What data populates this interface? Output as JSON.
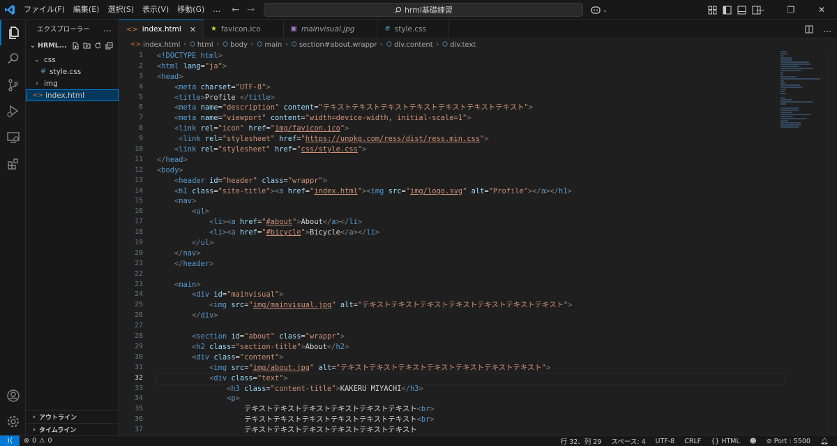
{
  "menu": [
    "ファイル(F)",
    "編集(E)",
    "選択(S)",
    "表示(V)",
    "移動(G)",
    "…"
  ],
  "search": {
    "text": "hrml基礎練習"
  },
  "sidebar": {
    "title": "エクスプローラー",
    "more": "…",
    "folder": "HRML...",
    "items": [
      {
        "label": "css",
        "type": "folder",
        "open": true
      },
      {
        "label": "style.css",
        "type": "css"
      },
      {
        "label": "img",
        "type": "folder",
        "open": false
      },
      {
        "label": "index.html",
        "type": "html",
        "selected": true
      }
    ],
    "outline": "アウトライン",
    "timeline": "タイムライン"
  },
  "tabs": [
    {
      "label": "index.html",
      "icon": "<>",
      "active": true,
      "close": "✕"
    },
    {
      "label": "favicon.ico",
      "icon": "★"
    },
    {
      "label": "mainvisual.jpg",
      "icon": "▣"
    },
    {
      "label": "style.css",
      "icon": "#"
    }
  ],
  "breadcrumb": [
    "index.html",
    "html",
    "body",
    "main",
    "section#about.wrappr",
    "div.content",
    "div.text"
  ],
  "editor": {
    "current_line": 32,
    "lines": [
      [
        [
          "doctype",
          "<!DOCTYPE "
        ],
        [
          "tag",
          "html"
        ],
        [
          "punct",
          ">"
        ]
      ],
      [
        [
          "punct",
          "<"
        ],
        [
          "tag",
          "html"
        ],
        [
          "text",
          " "
        ],
        [
          "attr",
          "lang"
        ],
        [
          "text",
          "="
        ],
        [
          "str",
          "\"ja\""
        ],
        [
          "punct",
          ">"
        ]
      ],
      [
        [
          "punct",
          "<"
        ],
        [
          "tag",
          "head"
        ],
        [
          "punct",
          ">"
        ]
      ],
      [
        [
          "text",
          "    "
        ],
        [
          "punct",
          "<"
        ],
        [
          "tag",
          "meta"
        ],
        [
          "text",
          " "
        ],
        [
          "attr",
          "charset"
        ],
        [
          "text",
          "="
        ],
        [
          "str",
          "\"UTF-8\""
        ],
        [
          "punct",
          ">"
        ]
      ],
      [
        [
          "text",
          "    "
        ],
        [
          "punct",
          "<"
        ],
        [
          "tag",
          "title"
        ],
        [
          "punct",
          ">"
        ],
        [
          "text",
          "Profile "
        ],
        [
          "punct",
          "</"
        ],
        [
          "tag",
          "title"
        ],
        [
          "punct",
          ">"
        ]
      ],
      [
        [
          "text",
          "    "
        ],
        [
          "punct",
          "<"
        ],
        [
          "tag",
          "meta"
        ],
        [
          "text",
          " "
        ],
        [
          "attr",
          "name"
        ],
        [
          "text",
          "="
        ],
        [
          "str",
          "\"description\""
        ],
        [
          "text",
          " "
        ],
        [
          "attr",
          "content"
        ],
        [
          "text",
          "="
        ],
        [
          "str",
          "\"テキストテキストテキストテキストテキストテキストテキスト\""
        ],
        [
          "punct",
          ">"
        ]
      ],
      [
        [
          "text",
          "    "
        ],
        [
          "punct",
          "<"
        ],
        [
          "tag",
          "meta"
        ],
        [
          "text",
          " "
        ],
        [
          "attr",
          "name"
        ],
        [
          "text",
          "="
        ],
        [
          "str",
          "\"viewport\""
        ],
        [
          "text",
          " "
        ],
        [
          "attr",
          "content"
        ],
        [
          "text",
          "="
        ],
        [
          "str",
          "\"width=device-width, initial-scale=1\""
        ],
        [
          "punct",
          ">"
        ]
      ],
      [
        [
          "text",
          "    "
        ],
        [
          "punct",
          "<"
        ],
        [
          "tag",
          "link"
        ],
        [
          "text",
          " "
        ],
        [
          "attr",
          "rel"
        ],
        [
          "text",
          "="
        ],
        [
          "str",
          "\"icon\""
        ],
        [
          "text",
          " "
        ],
        [
          "attr",
          "href"
        ],
        [
          "text",
          "="
        ],
        [
          "str",
          "\""
        ],
        [
          "link",
          "img/favicon.ico"
        ],
        [
          "str",
          "\""
        ],
        [
          "punct",
          ">"
        ]
      ],
      [
        [
          "text",
          "     "
        ],
        [
          "punct",
          "<"
        ],
        [
          "tag",
          "link"
        ],
        [
          "text",
          " "
        ],
        [
          "attr",
          "rel"
        ],
        [
          "text",
          "="
        ],
        [
          "str",
          "\"stylesheet\""
        ],
        [
          "text",
          " "
        ],
        [
          "attr",
          "href"
        ],
        [
          "text",
          "="
        ],
        [
          "str",
          "\""
        ],
        [
          "link",
          "https://unpkg.com/ress/dist/ress.min.css"
        ],
        [
          "str",
          "\""
        ],
        [
          "punct",
          ">"
        ]
      ],
      [
        [
          "text",
          "    "
        ],
        [
          "punct",
          "<"
        ],
        [
          "tag",
          "link"
        ],
        [
          "text",
          " "
        ],
        [
          "attr",
          "rel"
        ],
        [
          "text",
          "="
        ],
        [
          "str",
          "\"stylesheet\""
        ],
        [
          "text",
          " "
        ],
        [
          "attr",
          "href"
        ],
        [
          "text",
          "="
        ],
        [
          "str",
          "\""
        ],
        [
          "link",
          "css/style.css"
        ],
        [
          "str",
          "\""
        ],
        [
          "punct",
          ">"
        ]
      ],
      [
        [
          "punct",
          "</"
        ],
        [
          "tag",
          "head"
        ],
        [
          "punct",
          ">"
        ]
      ],
      [
        [
          "punct",
          "<"
        ],
        [
          "tag",
          "body"
        ],
        [
          "punct",
          ">"
        ]
      ],
      [
        [
          "text",
          "    "
        ],
        [
          "punct",
          "<"
        ],
        [
          "tag",
          "header"
        ],
        [
          "text",
          " "
        ],
        [
          "attr",
          "id"
        ],
        [
          "text",
          "="
        ],
        [
          "str",
          "\"header\""
        ],
        [
          "text",
          " "
        ],
        [
          "attr",
          "class"
        ],
        [
          "text",
          "="
        ],
        [
          "str",
          "\"wrappr\""
        ],
        [
          "punct",
          ">"
        ]
      ],
      [
        [
          "text",
          "    "
        ],
        [
          "punct",
          "<"
        ],
        [
          "tag",
          "h1"
        ],
        [
          "text",
          " "
        ],
        [
          "attr",
          "class"
        ],
        [
          "text",
          "="
        ],
        [
          "str",
          "\"site-title\""
        ],
        [
          "punct",
          "><"
        ],
        [
          "tag",
          "a"
        ],
        [
          "text",
          " "
        ],
        [
          "attr",
          "href"
        ],
        [
          "text",
          "="
        ],
        [
          "str",
          "\""
        ],
        [
          "link",
          "index.html"
        ],
        [
          "str",
          "\""
        ],
        [
          "punct",
          "><"
        ],
        [
          "tag",
          "img"
        ],
        [
          "text",
          " "
        ],
        [
          "attr",
          "src"
        ],
        [
          "text",
          "="
        ],
        [
          "str",
          "\""
        ],
        [
          "link",
          "img/logo.svg"
        ],
        [
          "str",
          "\""
        ],
        [
          "text",
          " "
        ],
        [
          "attr",
          "alt"
        ],
        [
          "text",
          "="
        ],
        [
          "str",
          "\"Profile\""
        ],
        [
          "punct",
          "></"
        ],
        [
          "tag",
          "a"
        ],
        [
          "punct",
          "></"
        ],
        [
          "tag",
          "h1"
        ],
        [
          "punct",
          ">"
        ]
      ],
      [
        [
          "text",
          "    "
        ],
        [
          "punct",
          "<"
        ],
        [
          "tag",
          "nav"
        ],
        [
          "punct",
          ">"
        ]
      ],
      [
        [
          "text",
          "        "
        ],
        [
          "punct",
          "<"
        ],
        [
          "tag",
          "ul"
        ],
        [
          "punct",
          ">"
        ]
      ],
      [
        [
          "text",
          "            "
        ],
        [
          "punct",
          "<"
        ],
        [
          "tag",
          "li"
        ],
        [
          "punct",
          "><"
        ],
        [
          "tag",
          "a"
        ],
        [
          "text",
          " "
        ],
        [
          "attr",
          "href"
        ],
        [
          "text",
          "="
        ],
        [
          "str",
          "\""
        ],
        [
          "link",
          "#about"
        ],
        [
          "str",
          "\""
        ],
        [
          "punct",
          ">"
        ],
        [
          "text",
          "About"
        ],
        [
          "punct",
          "</"
        ],
        [
          "tag",
          "a"
        ],
        [
          "punct",
          "></"
        ],
        [
          "tag",
          "li"
        ],
        [
          "punct",
          ">"
        ]
      ],
      [
        [
          "text",
          "            "
        ],
        [
          "punct",
          "<"
        ],
        [
          "tag",
          "li"
        ],
        [
          "punct",
          "><"
        ],
        [
          "tag",
          "a"
        ],
        [
          "text",
          " "
        ],
        [
          "attr",
          "href"
        ],
        [
          "text",
          "="
        ],
        [
          "str",
          "\""
        ],
        [
          "link",
          "#bicycle"
        ],
        [
          "str",
          "\""
        ],
        [
          "punct",
          ">"
        ],
        [
          "text",
          "Bicycle"
        ],
        [
          "punct",
          "</"
        ],
        [
          "tag",
          "a"
        ],
        [
          "punct",
          "></"
        ],
        [
          "tag",
          "li"
        ],
        [
          "punct",
          ">"
        ]
      ],
      [
        [
          "text",
          "        "
        ],
        [
          "punct",
          "</"
        ],
        [
          "tag",
          "ul"
        ],
        [
          "punct",
          ">"
        ]
      ],
      [
        [
          "text",
          "    "
        ],
        [
          "punct",
          "</"
        ],
        [
          "tag",
          "nav"
        ],
        [
          "punct",
          ">"
        ]
      ],
      [
        [
          "text",
          "    "
        ],
        [
          "punct",
          "</"
        ],
        [
          "tag",
          "header"
        ],
        [
          "punct",
          ">"
        ]
      ],
      [],
      [
        [
          "text",
          "    "
        ],
        [
          "punct",
          "<"
        ],
        [
          "tag",
          "main"
        ],
        [
          "punct",
          ">"
        ]
      ],
      [
        [
          "text",
          "        "
        ],
        [
          "punct",
          "<"
        ],
        [
          "tag",
          "div"
        ],
        [
          "text",
          " "
        ],
        [
          "attr",
          "id"
        ],
        [
          "text",
          "="
        ],
        [
          "str",
          "\"mainvisual\""
        ],
        [
          "punct",
          ">"
        ]
      ],
      [
        [
          "text",
          "            "
        ],
        [
          "punct",
          "<"
        ],
        [
          "tag",
          "img"
        ],
        [
          "text",
          " "
        ],
        [
          "attr",
          "src"
        ],
        [
          "text",
          "="
        ],
        [
          "str",
          "\""
        ],
        [
          "link",
          "img/mainvisual.jpg"
        ],
        [
          "str",
          "\""
        ],
        [
          "text",
          " "
        ],
        [
          "attr",
          "alt"
        ],
        [
          "text",
          "="
        ],
        [
          "str",
          "\"テキストテキストテキストテキストテキストテキストテキスト\""
        ],
        [
          "punct",
          ">"
        ]
      ],
      [
        [
          "text",
          "        "
        ],
        [
          "punct",
          "</"
        ],
        [
          "tag",
          "div"
        ],
        [
          "punct",
          ">"
        ]
      ],
      [],
      [
        [
          "text",
          "        "
        ],
        [
          "punct",
          "<"
        ],
        [
          "tag",
          "section"
        ],
        [
          "text",
          " "
        ],
        [
          "attr",
          "id"
        ],
        [
          "text",
          "="
        ],
        [
          "str",
          "\"about\""
        ],
        [
          "text",
          " "
        ],
        [
          "attr",
          "class"
        ],
        [
          "text",
          "="
        ],
        [
          "str",
          "\"wrappr\""
        ],
        [
          "punct",
          ">"
        ]
      ],
      [
        [
          "text",
          "        "
        ],
        [
          "punct",
          "<"
        ],
        [
          "tag",
          "h2"
        ],
        [
          "text",
          " "
        ],
        [
          "attr",
          "class"
        ],
        [
          "text",
          "="
        ],
        [
          "str",
          "\"section-title\""
        ],
        [
          "punct",
          ">"
        ],
        [
          "text",
          "About"
        ],
        [
          "punct",
          "</"
        ],
        [
          "tag",
          "h2"
        ],
        [
          "punct",
          ">"
        ]
      ],
      [
        [
          "text",
          "        "
        ],
        [
          "punct",
          "<"
        ],
        [
          "tag",
          "div"
        ],
        [
          "text",
          " "
        ],
        [
          "attr",
          "class"
        ],
        [
          "text",
          "="
        ],
        [
          "str",
          "\"content\""
        ],
        [
          "punct",
          ">"
        ]
      ],
      [
        [
          "text",
          "            "
        ],
        [
          "punct",
          "<"
        ],
        [
          "tag",
          "img"
        ],
        [
          "text",
          " "
        ],
        [
          "attr",
          "src"
        ],
        [
          "text",
          "="
        ],
        [
          "str",
          "\""
        ],
        [
          "link",
          "img/about.jpg"
        ],
        [
          "str",
          "\""
        ],
        [
          "text",
          " "
        ],
        [
          "attr",
          "alt"
        ],
        [
          "text",
          "="
        ],
        [
          "str",
          "\"テキストテキストテキストテキストテキストテキストテキスト\""
        ],
        [
          "punct",
          ">"
        ]
      ],
      [
        [
          "text",
          "            "
        ],
        [
          "punct",
          "<"
        ],
        [
          "tag",
          "div"
        ],
        [
          "text",
          " "
        ],
        [
          "attr",
          "class"
        ],
        [
          "text",
          "="
        ],
        [
          "str",
          "\"text\""
        ],
        [
          "punct",
          ">"
        ]
      ],
      [
        [
          "text",
          "                "
        ],
        [
          "punct",
          "<"
        ],
        [
          "tag",
          "h3"
        ],
        [
          "text",
          " "
        ],
        [
          "attr",
          "class"
        ],
        [
          "text",
          "="
        ],
        [
          "str",
          "\"content-title\""
        ],
        [
          "punct",
          ">"
        ],
        [
          "text",
          "KAKERU MIYACHI"
        ],
        [
          "punct",
          "</"
        ],
        [
          "tag",
          "h3"
        ],
        [
          "punct",
          ">"
        ]
      ],
      [
        [
          "text",
          "                "
        ],
        [
          "punct",
          "<"
        ],
        [
          "tag",
          "p"
        ],
        [
          "punct",
          ">"
        ]
      ],
      [
        [
          "text",
          "                    テキストテキストテキストテキストテキストテキスト"
        ],
        [
          "punct",
          "<"
        ],
        [
          "tag",
          "br"
        ],
        [
          "punct",
          ">"
        ]
      ],
      [
        [
          "text",
          "                    テキストテキストテキストテキストテキストテキスト"
        ],
        [
          "punct",
          "<"
        ],
        [
          "tag",
          "br"
        ],
        [
          "punct",
          ">"
        ]
      ],
      [
        [
          "text",
          "                    テキストテキストテキストテキストテキストテキスト"
        ]
      ]
    ]
  },
  "status": {
    "errors": "0",
    "warnings": "0",
    "position": "行 32、列 29",
    "spaces": "スペース: 4",
    "encoding": "UTF-8",
    "eol": "CRLF",
    "language": "HTML",
    "port": "Port : 5500"
  },
  "colors": {
    "accent": "#0078d4",
    "tag": "#569cd6",
    "attr": "#9cdcfe",
    "string": "#ce9178"
  }
}
